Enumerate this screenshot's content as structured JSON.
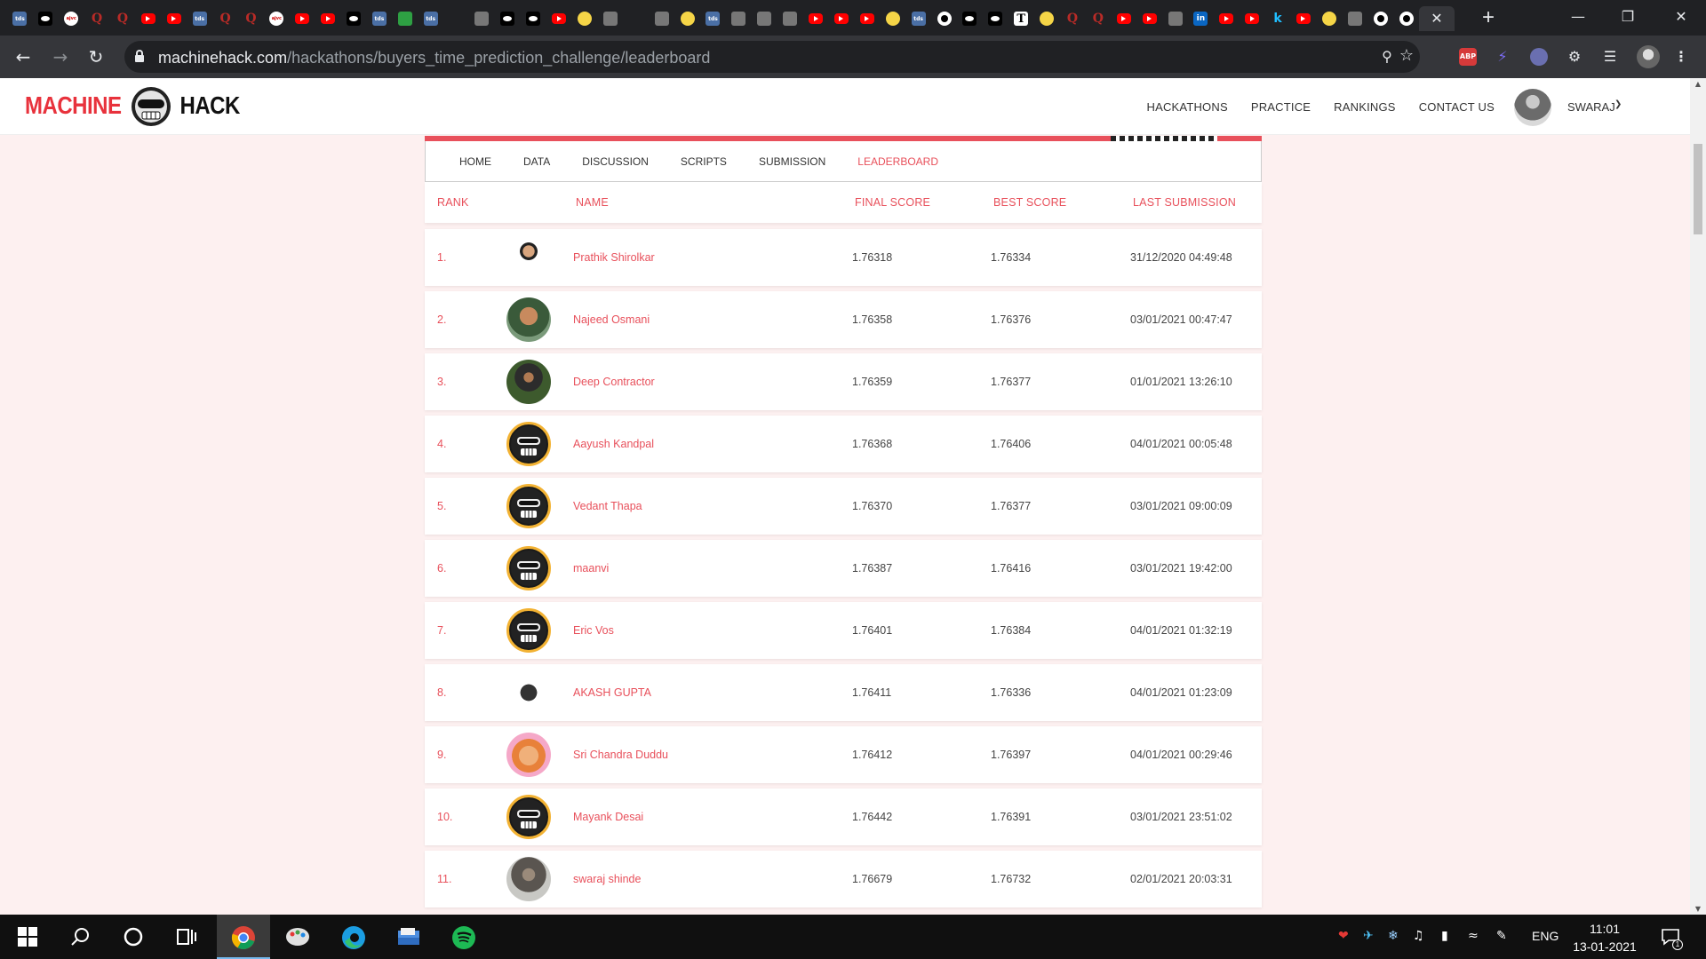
{
  "browser": {
    "tab_favicons": [
      "tds",
      "medium",
      "ajvc",
      "quora",
      "quora",
      "youtube",
      "youtube",
      "tds",
      "quora",
      "quora",
      "ajvc",
      "youtube",
      "youtube",
      "medium",
      "tds",
      "green",
      "tds",
      "twitter",
      "misc",
      "medium",
      "medium",
      "youtube",
      "tout",
      "misc",
      "twitter",
      "misc",
      "tout",
      "tds",
      "misc",
      "misc",
      "misc",
      "youtube",
      "youtube",
      "youtube",
      "tout",
      "tds",
      "github",
      "medium",
      "medium",
      "text",
      "tout",
      "quora",
      "quora",
      "youtube",
      "youtube",
      "misc",
      "linkedin",
      "youtube",
      "youtube",
      "kaggle",
      "youtube",
      "tout",
      "misc",
      "github",
      "github"
    ],
    "tab_text": {
      "tds": "tds",
      "ajvc": "ajvc",
      "quora": "Q",
      "text": "T",
      "linkedin": "in",
      "kaggle": "k"
    },
    "url_host": "machinehack.com",
    "url_path": "/hackathons/buyers_time_prediction_challenge/leaderboard",
    "extensions": {
      "abp": "ABP"
    }
  },
  "site": {
    "logo_left": "MACHINE",
    "logo_right": "HACK",
    "nav": [
      "HACKATHONS",
      "PRACTICE",
      "RANKINGS",
      "CONTACT US"
    ],
    "user": "SWARAJ"
  },
  "subnav": {
    "tabs": [
      "HOME",
      "DATA",
      "DISCUSSION",
      "SCRIPTS",
      "SUBMISSION",
      "LEADERBOARD"
    ],
    "active": "LEADERBOARD"
  },
  "leaderboard": {
    "headers": {
      "rank": "RANK",
      "name": "NAME",
      "final": "FINAL SCORE",
      "best": "BEST SCORE",
      "last": "LAST SUBMISSION"
    },
    "rows": [
      {
        "rank": "1.",
        "name": "Prathik Shirolkar",
        "final": "1.76318",
        "best": "1.76334",
        "last": "31/12/2020 04:49:48",
        "avatar": "photo-a"
      },
      {
        "rank": "2.",
        "name": "Najeed Osmani",
        "final": "1.76358",
        "best": "1.76376",
        "last": "03/01/2021 00:47:47",
        "avatar": "photo-b"
      },
      {
        "rank": "3.",
        "name": "Deep Contractor",
        "final": "1.76359",
        "best": "1.76377",
        "last": "01/01/2021 13:26:10",
        "avatar": "photo-c"
      },
      {
        "rank": "4.",
        "name": "Aayush Kandpal",
        "final": "1.76368",
        "best": "1.76406",
        "last": "04/01/2021 00:05:48",
        "avatar": "mh"
      },
      {
        "rank": "5.",
        "name": "Vedant Thapa",
        "final": "1.76370",
        "best": "1.76377",
        "last": "03/01/2021 09:00:09",
        "avatar": "mh"
      },
      {
        "rank": "6.",
        "name": "maanvi",
        "final": "1.76387",
        "best": "1.76416",
        "last": "03/01/2021 19:42:00",
        "avatar": "mh"
      },
      {
        "rank": "7.",
        "name": "Eric Vos",
        "final": "1.76401",
        "best": "1.76384",
        "last": "04/01/2021 01:32:19",
        "avatar": "mh"
      },
      {
        "rank": "8.",
        "name": "AKASH GUPTA",
        "final": "1.76411",
        "best": "1.76336",
        "last": "04/01/2021 01:23:09",
        "avatar": "photo-d"
      },
      {
        "rank": "9.",
        "name": "Sri Chandra Duddu",
        "final": "1.76412",
        "best": "1.76397",
        "last": "04/01/2021 00:29:46",
        "avatar": "photo-e"
      },
      {
        "rank": "10.",
        "name": "Mayank Desai",
        "final": "1.76442",
        "best": "1.76391",
        "last": "03/01/2021 23:51:02",
        "avatar": "mh"
      },
      {
        "rank": "11.",
        "name": "swaraj shinde",
        "final": "1.76679",
        "best": "1.76732",
        "last": "02/01/2021 20:03:31",
        "avatar": "photo-f"
      }
    ]
  },
  "taskbar": {
    "apps": [
      "windows-start-icon",
      "search-icon",
      "cortana-icon",
      "task-view-icon",
      "chrome-icon",
      "paint-icon",
      "edge-icon",
      "file-explorer-icon",
      "spotify-icon"
    ],
    "language": "ENG",
    "time": "11:01",
    "date": "13-01-2021",
    "notification_count": "1"
  },
  "colors": {
    "accent": "#e8505b",
    "chrome_dark": "#202124",
    "chrome_toolbar": "#35363a",
    "page_bg": "#fdf0f0",
    "spotify": "#1db954"
  }
}
